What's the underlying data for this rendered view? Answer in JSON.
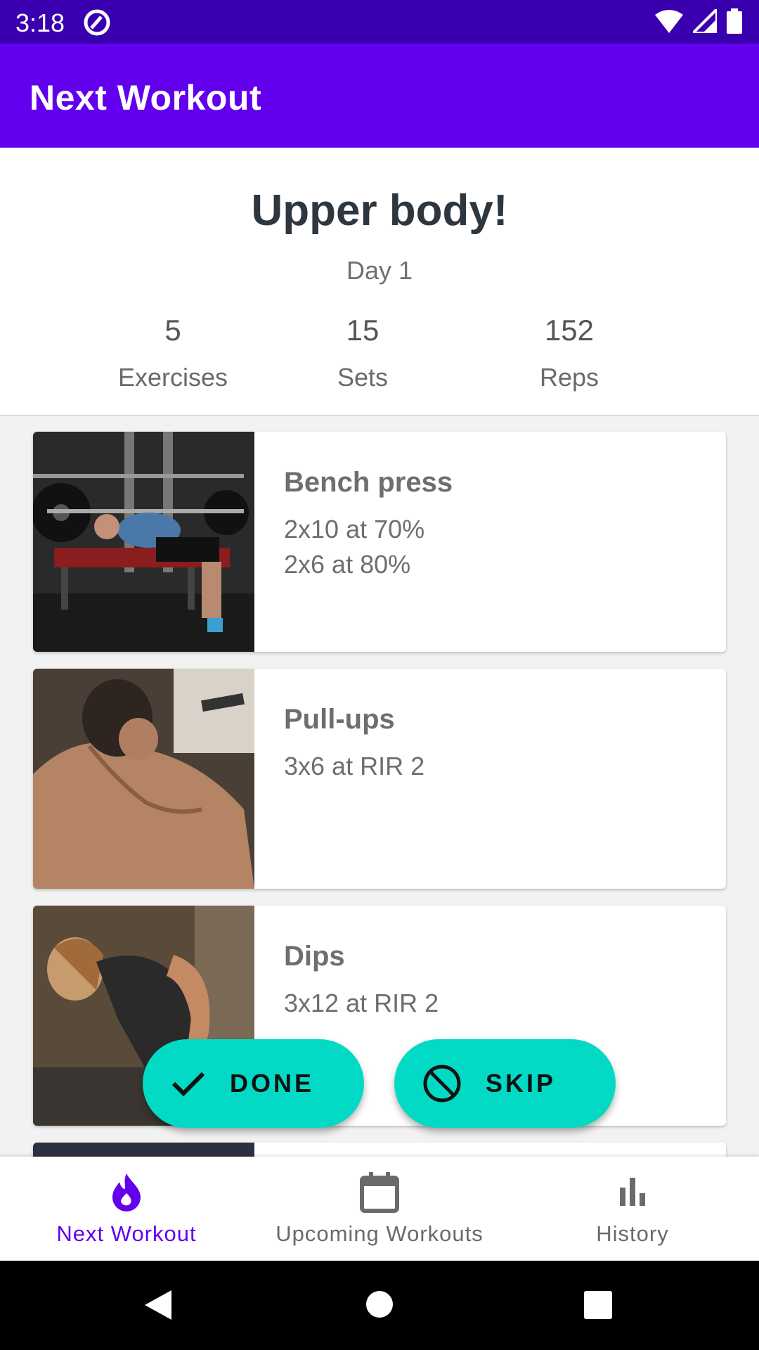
{
  "status_bar": {
    "time": "3:18"
  },
  "app_bar": {
    "title": "Next Workout"
  },
  "summary": {
    "title": "Upper body!",
    "day": "Day 1",
    "stats": [
      {
        "value": "5",
        "label": "Exercises"
      },
      {
        "value": "15",
        "label": "Sets"
      },
      {
        "value": "152",
        "label": "Reps"
      }
    ]
  },
  "exercises": [
    {
      "name": "Bench press",
      "lines": [
        "2x10 at 70%",
        "2x6 at 80%"
      ]
    },
    {
      "name": "Pull-ups",
      "lines": [
        "3x6 at RIR 2"
      ]
    },
    {
      "name": "Dips",
      "lines": [
        "3x12 at RIR 2"
      ]
    }
  ],
  "actions": {
    "done": "DONE",
    "skip": "SKIP"
  },
  "bottom_nav": {
    "items": [
      {
        "label": "Next Workout",
        "icon": "flame-icon",
        "active": true
      },
      {
        "label": "Upcoming Workouts",
        "icon": "calendar-icon",
        "active": false
      },
      {
        "label": "History",
        "icon": "bar-chart-icon",
        "active": false
      }
    ]
  },
  "colors": {
    "primary": "#6200ee",
    "status_bar": "#3a00b0",
    "accent": "#03dac5",
    "active_nav": "#6200ee",
    "inactive_nav": "#6a6a6a"
  }
}
